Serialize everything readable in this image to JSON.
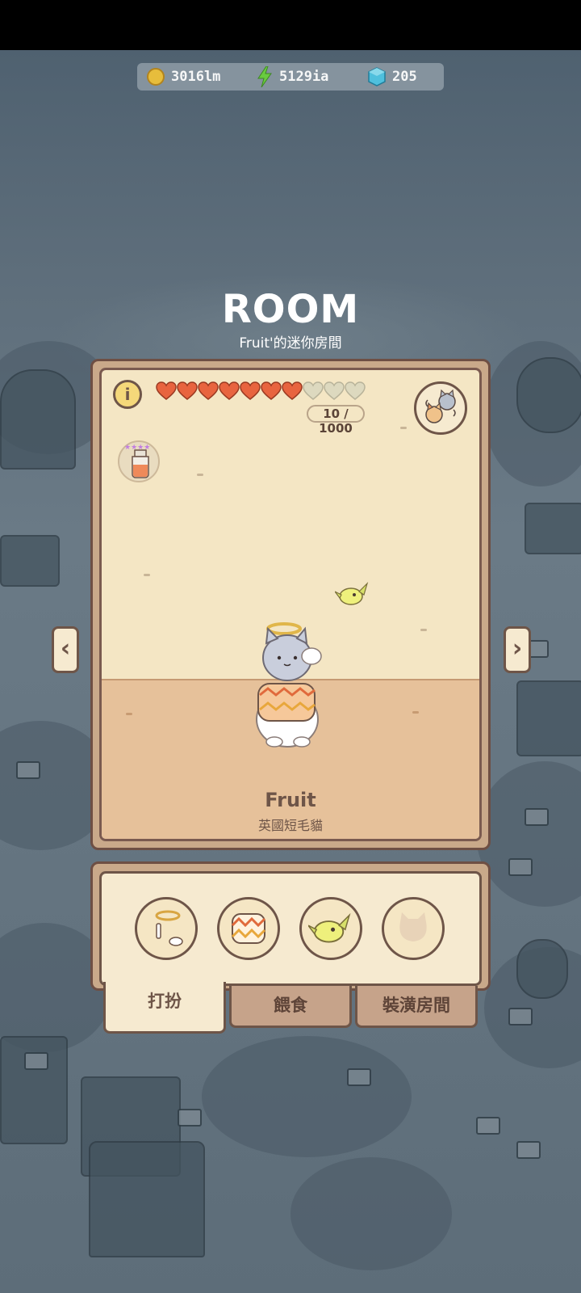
{
  "currency": {
    "coins": "3016lm",
    "energy": "5129ia",
    "gems": "205"
  },
  "header": {
    "title": "ROOM",
    "subtitle": "Fruit'的迷你房間"
  },
  "room": {
    "hearts_filled": 7,
    "hearts_total": 10,
    "hp_text": "10 / 1000"
  },
  "pet": {
    "name": "Fruit",
    "breed": "英國短毛貓"
  },
  "tabs": [
    {
      "label": "打扮"
    },
    {
      "label": "餵食"
    },
    {
      "label": "裝潢房間"
    }
  ],
  "icons": {
    "coin": "coin-icon",
    "energy": "lightning-icon",
    "gem": "gem-icon"
  },
  "colors": {
    "heart_filled": "#e8643f",
    "heart_empty": "#ddd9bf",
    "frame_border": "#6e4f44"
  }
}
